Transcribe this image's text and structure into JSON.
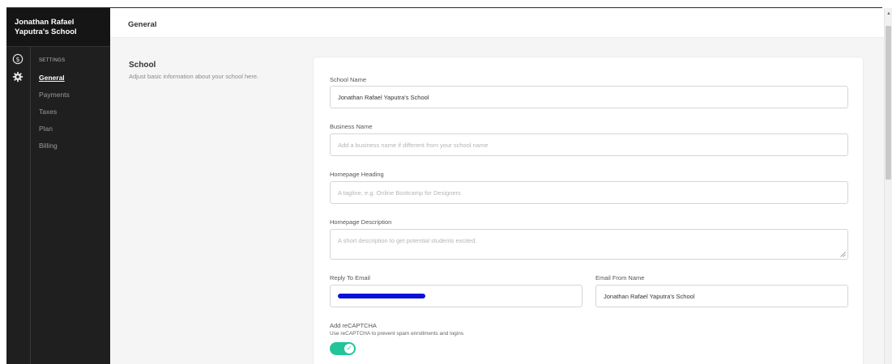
{
  "sidebar": {
    "school_name": "Jonathan Rafael Yaputra's School",
    "rail_icons": [
      "dollar-circle-icon",
      "gear-icon"
    ],
    "settings_heading": "SETTINGS",
    "items": [
      {
        "label": "General",
        "active": true
      },
      {
        "label": "Payments",
        "active": false
      },
      {
        "label": "Taxes",
        "active": false
      },
      {
        "label": "Plan",
        "active": false
      },
      {
        "label": "Billing",
        "active": false
      }
    ]
  },
  "header": {
    "title": "General"
  },
  "section": {
    "title": "School",
    "description": "Adjust basic information about your school here."
  },
  "form": {
    "school_name": {
      "label": "School Name",
      "value": "Jonathan Rafael Yaputra's School"
    },
    "business_name": {
      "label": "Business Name",
      "placeholder": "Add a business name if different from your school name"
    },
    "homepage_heading": {
      "label": "Homepage Heading",
      "placeholder": "A tagline, e.g. Online Bootcamp for Designers"
    },
    "homepage_description": {
      "label": "Homepage Description",
      "placeholder": "A short description to get potential students excited."
    },
    "reply_to_email": {
      "label": "Reply To Email"
    },
    "email_from_name": {
      "label": "Email From Name",
      "value": "Jonathan Rafael Yaputra's School"
    },
    "recaptcha": {
      "label": "Add reCAPTCHA",
      "description": "Use reCAPTCHA to prevent spam enrollments and logins",
      "enabled": true
    }
  },
  "colors": {
    "sidebar_bg": "#1f1f1f",
    "toggle_on": "#22c59a",
    "redaction": "#0b12d8"
  }
}
